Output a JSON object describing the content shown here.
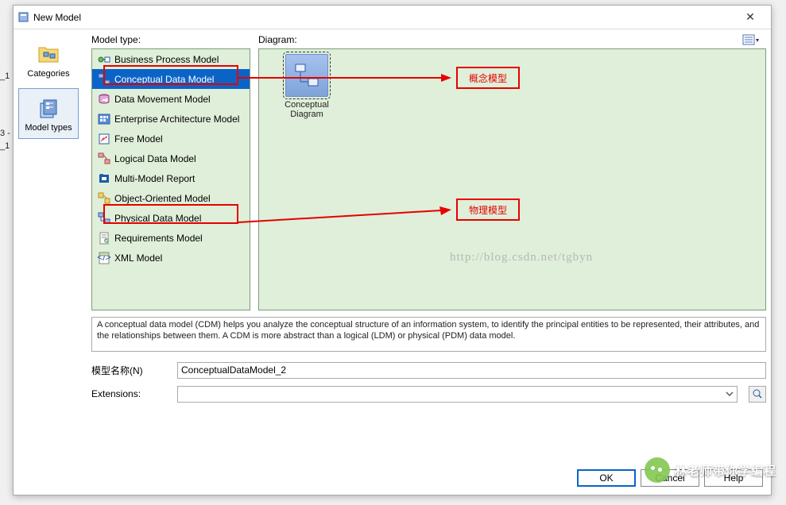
{
  "hidden_rows": [
    "_1",
    "3 -",
    "_1"
  ],
  "dialog": {
    "title": "New Model",
    "description": "A conceptual data model (CDM) helps you analyze the conceptual structure of an information system, to identify the principal entities to be represented, their attributes, and the relationships between them. A CDM is more abstract than a logical (LDM) or physical (PDM) data model."
  },
  "nav": {
    "categories": "Categories",
    "model_types": "Model types"
  },
  "labels": {
    "model_type": "Model type:",
    "diagram": "Diagram:"
  },
  "model_types": [
    {
      "label": "Business Process Model",
      "selected": false
    },
    {
      "label": "Conceptual Data Model",
      "selected": true
    },
    {
      "label": "Data Movement Model",
      "selected": false
    },
    {
      "label": "Enterprise Architecture Model",
      "selected": false
    },
    {
      "label": "Free Model",
      "selected": false
    },
    {
      "label": "Logical Data Model",
      "selected": false
    },
    {
      "label": "Multi-Model Report",
      "selected": false
    },
    {
      "label": "Object-Oriented Model",
      "selected": false
    },
    {
      "label": "Physical Data Model",
      "selected": false
    },
    {
      "label": "Requirements Model",
      "selected": false
    },
    {
      "label": "XML Model",
      "selected": false
    }
  ],
  "diagram_item": "Conceptual Diagram",
  "form": {
    "name_label": "模型名称(N)",
    "name_value": "ConceptualDataModel_2",
    "ext_label": "Extensions:",
    "ext_value": ""
  },
  "buttons": {
    "ok": "OK",
    "cancel": "Cancel",
    "help": "Help"
  },
  "annotations": {
    "concept": "概念模型",
    "physical": "物理模型"
  },
  "watermark": "http://blog.csdn.net/tgbyn",
  "attribution": "林老师带你学编程"
}
